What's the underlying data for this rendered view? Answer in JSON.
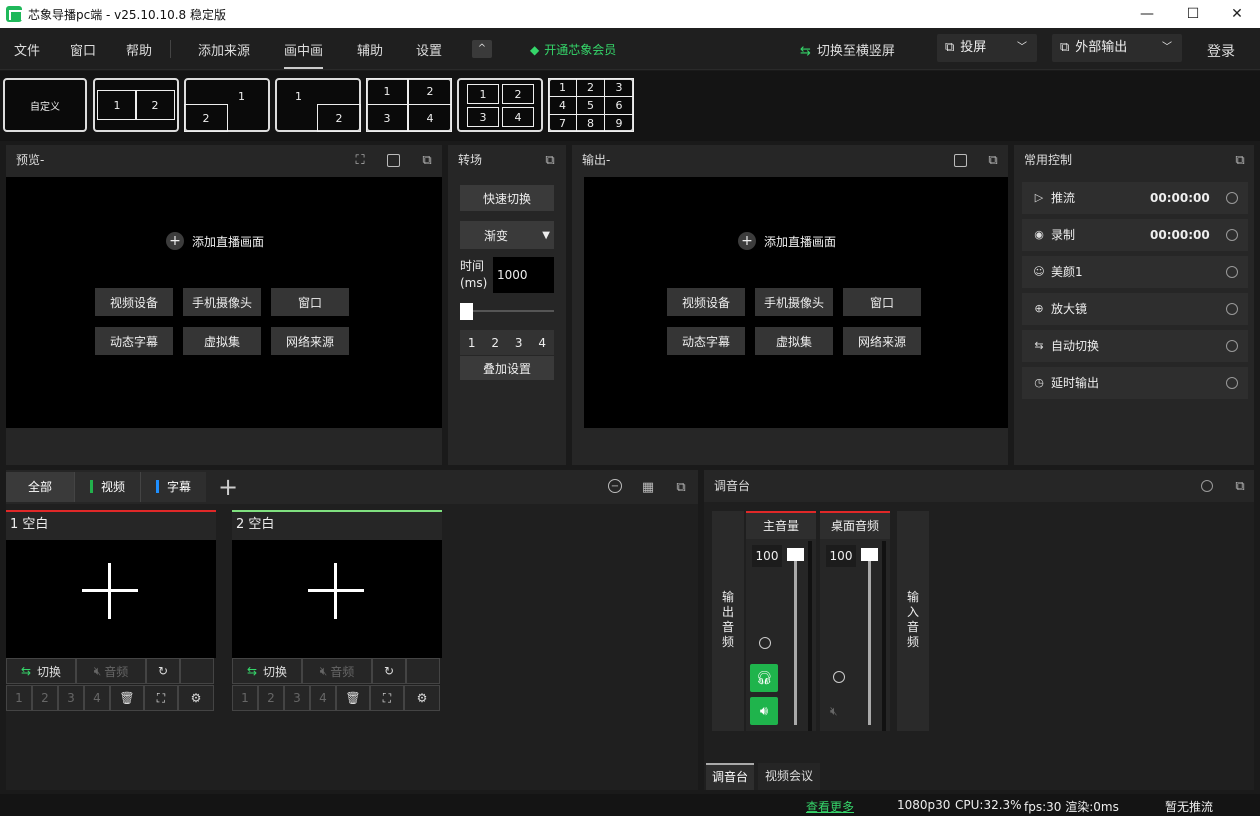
{
  "titlebar": {
    "title": "芯象导播pc端 - v25.10.10.8 稳定版",
    "minimize": "—",
    "maximize": "☐",
    "close": "✕"
  },
  "menu": {
    "file": "文件",
    "window": "窗口",
    "help": "帮助",
    "add_source": "添加来源",
    "pip": "画中画",
    "assist": "辅助",
    "settings": "设置",
    "collapse": "^",
    "vip": "开通芯象会员",
    "switch_orientation": "切换至横竖屏",
    "cast": "投屏",
    "external_output": "外部输出",
    "login": "登录"
  },
  "layouts": {
    "custom": "自定义",
    "l2": [
      "1",
      "2"
    ],
    "l3": [
      "1",
      "2"
    ],
    "l4": [
      "1",
      "2"
    ],
    "l5": [
      "1",
      "2",
      "3",
      "4"
    ],
    "l6": [
      "1",
      "2",
      "3",
      "4"
    ],
    "l7": [
      "1",
      "2",
      "3",
      "4",
      "5",
      "6",
      "7",
      "8",
      "9"
    ]
  },
  "preview": {
    "title": "预览-",
    "add_label": "添加直播画面",
    "buttons": [
      "视频设备",
      "手机摄像头",
      "窗口",
      "动态字幕",
      "虚拟集",
      "网络来源"
    ]
  },
  "transition": {
    "title": "转场",
    "quick_switch": "快速切换",
    "mode": "渐变",
    "time_label": "时间(ms)",
    "time_value": "1000",
    "slots": [
      "1",
      "2",
      "3",
      "4"
    ],
    "overlay_settings": "叠加设置",
    "slider_level": 0
  },
  "output": {
    "title": "输出-",
    "add_label": "添加直播画面",
    "buttons": [
      "视频设备",
      "手机摄像头",
      "窗口",
      "动态字幕",
      "虚拟集",
      "网络来源"
    ]
  },
  "controls": {
    "title": "常用控制",
    "items": [
      {
        "label": "推流",
        "time": "00:00:00",
        "icon": "play-icon"
      },
      {
        "label": "录制",
        "time": "00:00:00",
        "icon": "record-icon"
      },
      {
        "label": "美颜1",
        "time": "",
        "icon": "beauty-icon"
      },
      {
        "label": "放大镜",
        "time": "",
        "icon": "magnifier-icon"
      },
      {
        "label": "自动切换",
        "time": "",
        "icon": "swap-icon"
      },
      {
        "label": "延时输出",
        "time": "",
        "icon": "timer-icon"
      }
    ]
  },
  "sources": {
    "tabs": [
      "全部",
      "视频",
      "字幕"
    ],
    "tab_colors": {
      "video": "#22b14c",
      "subtitle": "#1e8fff"
    },
    "cards": [
      {
        "title": "1 空白",
        "switch": "切换",
        "audio": "音频",
        "slots": [
          "1",
          "2",
          "3",
          "4"
        ],
        "accent": "#e02828"
      },
      {
        "title": "2 空白",
        "switch": "切换",
        "audio": "音频",
        "slots": [
          "1",
          "2",
          "3",
          "4"
        ],
        "accent": "#7fe07f"
      }
    ]
  },
  "mixer": {
    "title": "调音台",
    "output_audio": "输出音频",
    "input_audio": "输入音频",
    "channels": [
      {
        "name": "主音量",
        "value": "100"
      },
      {
        "name": "桌面音频",
        "value": "100"
      }
    ],
    "tabs": [
      "调音台",
      "视频会议"
    ]
  },
  "statusbar": {
    "more": "查看更多",
    "resolution": "1080p30",
    "cpu": "CPU:32.3%",
    "fps": "fps:30 渲染:0ms",
    "stream": "暂无推流"
  },
  "colors": {
    "accent_green": "#35d66a",
    "red": "#e02828",
    "bg": "#1a1a1a"
  }
}
